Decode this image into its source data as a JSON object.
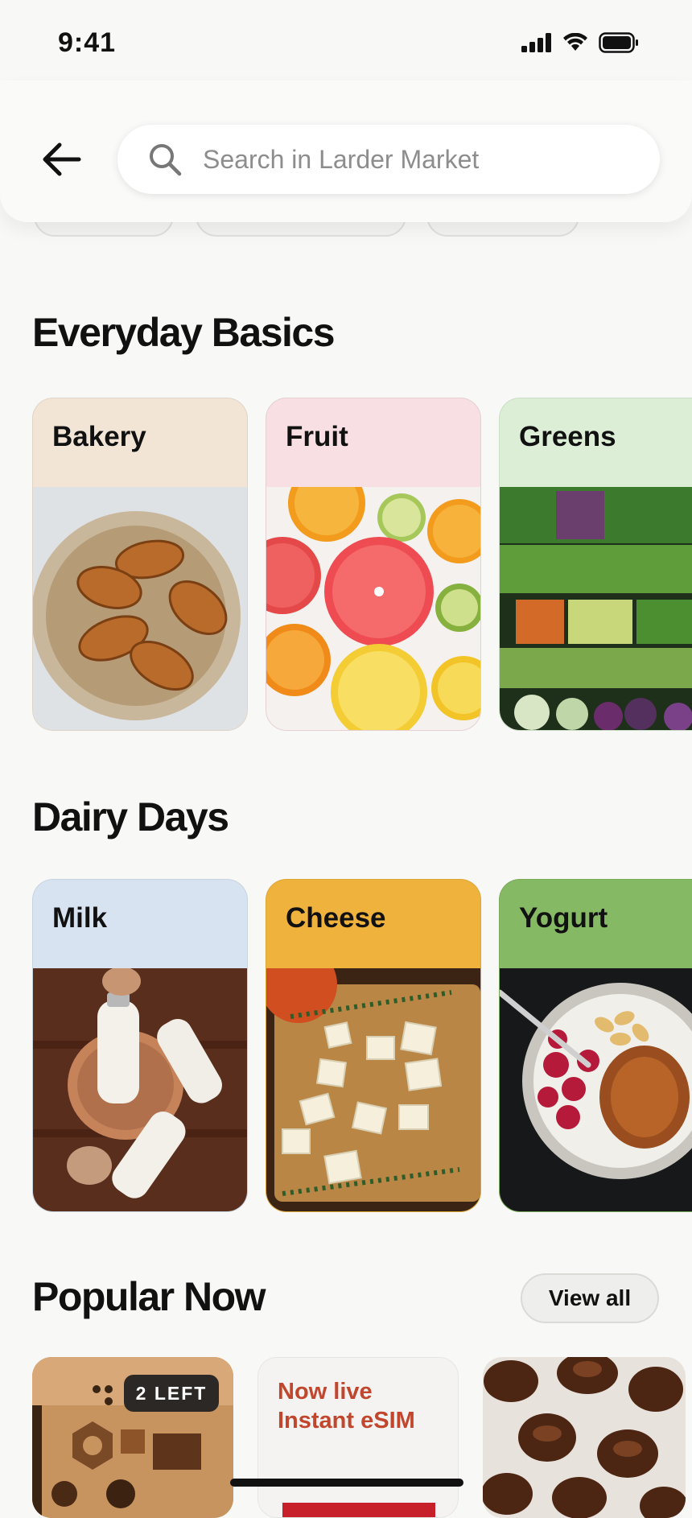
{
  "status_bar": {
    "time": "9:41"
  },
  "header": {
    "search_placeholder": "Search in Larder Market"
  },
  "sections": [
    {
      "title": "Everyday Basics",
      "cards": [
        {
          "label": "Bakery"
        },
        {
          "label": "Fruit"
        },
        {
          "label": "Greens"
        }
      ]
    },
    {
      "title": "Dairy Days",
      "cards": [
        {
          "label": "Milk"
        },
        {
          "label": "Cheese"
        },
        {
          "label": "Yogurt"
        }
      ]
    }
  ],
  "popular": {
    "title": "Popular Now",
    "view_all": "View all",
    "badge": "2 LEFT",
    "promo_line1": "Now live",
    "promo_line2": "Instant eSIM"
  },
  "colors": {
    "bakery": "#f2e5d6",
    "fruit": "#f7dfe3",
    "greens": "#dceed5",
    "milk": "#d8e3f2",
    "cheese": "#efb23c",
    "yogurt": "#86b963",
    "promo_text": "#c0462d"
  }
}
